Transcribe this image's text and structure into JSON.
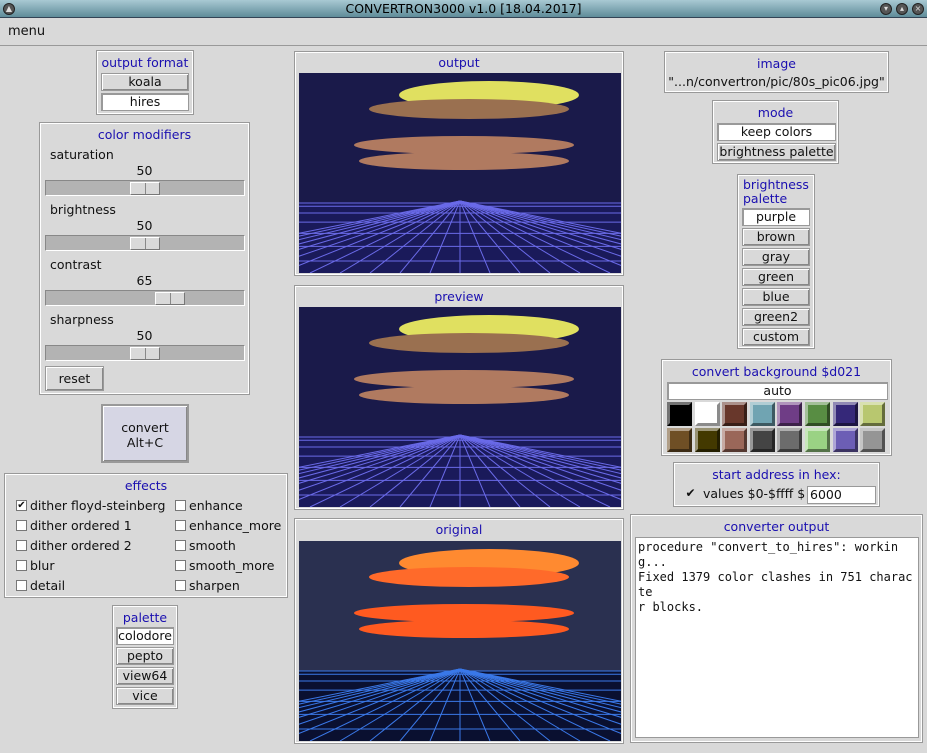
{
  "window": {
    "title": "CONVERTRON3000 v1.0 [18.04.2017]"
  },
  "menu": {
    "label": "menu"
  },
  "output_format": {
    "title": "output format",
    "options": [
      "koala",
      "hires"
    ],
    "selected": "hires"
  },
  "color_modifiers": {
    "title": "color modifiers",
    "sliders": [
      {
        "label": "saturation",
        "value": "50",
        "fraction": 0.5
      },
      {
        "label": "brightness",
        "value": "50",
        "fraction": 0.5
      },
      {
        "label": "contrast",
        "value": "65",
        "fraction": 0.65
      },
      {
        "label": "sharpness",
        "value": "50",
        "fraction": 0.5
      }
    ],
    "reset_label": "reset"
  },
  "convert": {
    "label": "convert",
    "shortcut": "Alt+C"
  },
  "effects": {
    "title": "effects",
    "items": [
      {
        "label": "dither floyd-steinberg",
        "checked": true
      },
      {
        "label": "dither ordered 1",
        "checked": false
      },
      {
        "label": "dither ordered 2",
        "checked": false
      },
      {
        "label": "blur",
        "checked": false
      },
      {
        "label": "detail",
        "checked": false
      },
      {
        "label": "enhance",
        "checked": false
      },
      {
        "label": "enhance_more",
        "checked": false
      },
      {
        "label": "smooth",
        "checked": false
      },
      {
        "label": "smooth_more",
        "checked": false
      },
      {
        "label": "sharpen",
        "checked": false
      }
    ]
  },
  "palette": {
    "title": "palette",
    "options": [
      "colodore",
      "pepto",
      "view64",
      "vice"
    ],
    "selected": "colodore"
  },
  "panels": {
    "output": "output",
    "preview": "preview",
    "original": "original"
  },
  "image": {
    "title": "image",
    "path": "\"...n/convertron/pic/80s_pic06.jpg\""
  },
  "mode": {
    "title": "mode",
    "options": [
      "keep colors",
      "brightness palette"
    ],
    "selected": "keep colors"
  },
  "brightness_palette": {
    "title_line1": "brightness",
    "title_line2": "palette",
    "options": [
      "purple",
      "brown",
      "gray",
      "green",
      "blue",
      "green2",
      "custom"
    ],
    "selected": "purple"
  },
  "background": {
    "title": "convert background $d021",
    "value": "auto",
    "colors": [
      "#000000",
      "#ffffff",
      "#68372b",
      "#70a4b2",
      "#6f3d86",
      "#588d43",
      "#352879",
      "#b8c76f",
      "#6f4f25",
      "#433900",
      "#9a6759",
      "#444444",
      "#6c6c6c",
      "#9ad284",
      "#6c5eb5",
      "#959595"
    ]
  },
  "start_address": {
    "title": "start address in hex:",
    "checkbox_label": "values $0-$ffff $",
    "checked": true,
    "value": "6000"
  },
  "converter_output": {
    "title": "converter output",
    "text": "procedure \"convert_to_hires\": working...\nFixed 1379 color clashes in 751 characte\nr blocks."
  },
  "colors": {
    "title_text": "#1a0fb0",
    "background": "#d9d9d9"
  }
}
